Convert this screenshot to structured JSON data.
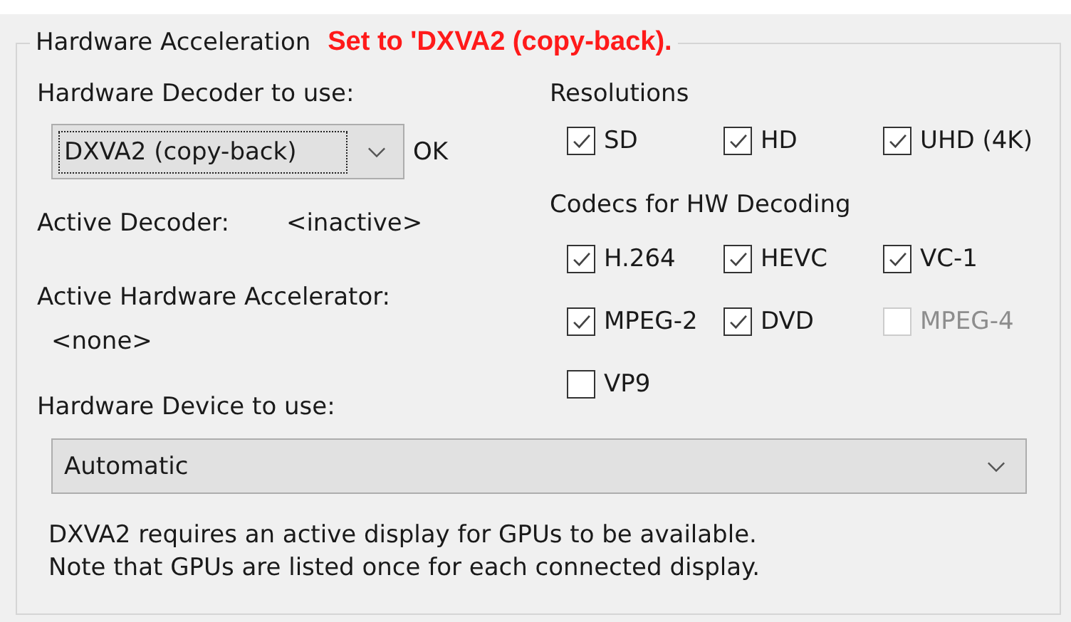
{
  "group": {
    "title": "Hardware Acceleration",
    "notice": "Set to 'DXVA2 (copy-back)."
  },
  "decoder": {
    "label": "Hardware Decoder to use:",
    "value": "DXVA2 (copy-back)",
    "focused": true,
    "status": "OK"
  },
  "active_decoder": {
    "label": "Active Decoder:",
    "value": "<inactive>"
  },
  "active_accelerator": {
    "label": "Active Hardware Accelerator:",
    "value": "<none>"
  },
  "device": {
    "label": "Hardware Device to use:",
    "value": "Automatic"
  },
  "resolutions": {
    "title": "Resolutions",
    "options": [
      {
        "label": "SD",
        "checked": true,
        "disabled": false
      },
      {
        "label": "HD",
        "checked": true,
        "disabled": false
      },
      {
        "label": "UHD (4K)",
        "checked": true,
        "disabled": false
      }
    ]
  },
  "codecs": {
    "title": "Codecs for HW Decoding",
    "options": [
      {
        "label": "H.264",
        "checked": true,
        "disabled": false
      },
      {
        "label": "HEVC",
        "checked": true,
        "disabled": false
      },
      {
        "label": "VC-1",
        "checked": true,
        "disabled": false
      },
      {
        "label": "MPEG-2",
        "checked": true,
        "disabled": false
      },
      {
        "label": "DVD",
        "checked": true,
        "disabled": false
      },
      {
        "label": "MPEG-4",
        "checked": false,
        "disabled": true
      },
      {
        "label": "VP9",
        "checked": false,
        "disabled": false
      }
    ]
  },
  "notes": [
    "DXVA2 requires an active display for GPUs to be available.",
    "Note that GPUs are listed once for each connected display."
  ]
}
